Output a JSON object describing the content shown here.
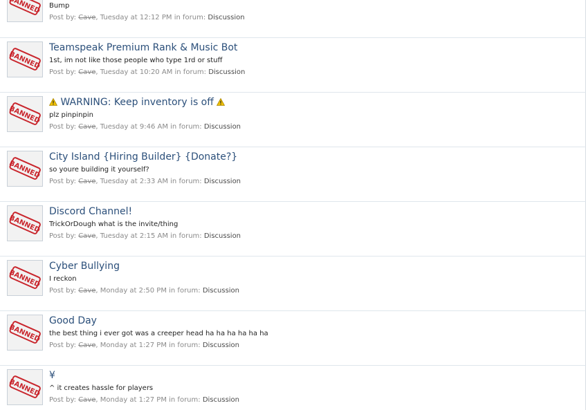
{
  "meta_labels": {
    "post_by": "Post by:",
    "comma": ",",
    "in_forum": "in forum:"
  },
  "avatar_stamp_text": "BANNED",
  "posts": [
    {
      "title": "",
      "excerpt": "Bump",
      "user": "Cave",
      "time": "Tuesday at 12:12 PM",
      "forum": "Discussion"
    },
    {
      "title": "Teamspeak Premium Rank & Music Bot",
      "excerpt": "1st, im not like those people who type 1rd or stuff",
      "user": "Cave",
      "time": "Tuesday at 10:20 AM",
      "forum": "Discussion"
    },
    {
      "title": "WARNING: Keep inventory is off",
      "excerpt": "plz pinpinpin",
      "user": "Cave",
      "time": "Tuesday at 9:46 AM",
      "forum": "Discussion"
    },
    {
      "title": "City Island {Hiring Builder} {Donate?}",
      "excerpt": "so youre building it yourself?",
      "user": "Cave",
      "time": "Tuesday at 2:33 AM",
      "forum": "Discussion"
    },
    {
      "title": "Discord Channel!",
      "excerpt": "TrickOrDough what is the invite/thing",
      "user": "Cave",
      "time": "Tuesday at 2:15 AM",
      "forum": "Discussion"
    },
    {
      "title": "Cyber Bullying",
      "excerpt": "I reckon",
      "user": "Cave",
      "time": "Monday at 2:50 PM",
      "forum": "Discussion"
    },
    {
      "title": "Good Day",
      "excerpt": "the best thing i ever got was a creeper head ha ha ha ha ha ha",
      "user": "Cave",
      "time": "Monday at 1:27 PM",
      "forum": "Discussion"
    },
    {
      "title": "¥",
      "excerpt": "^ it creates hassle for players",
      "user": "Cave",
      "time": "Monday at 1:27 PM",
      "forum": "Discussion"
    }
  ]
}
